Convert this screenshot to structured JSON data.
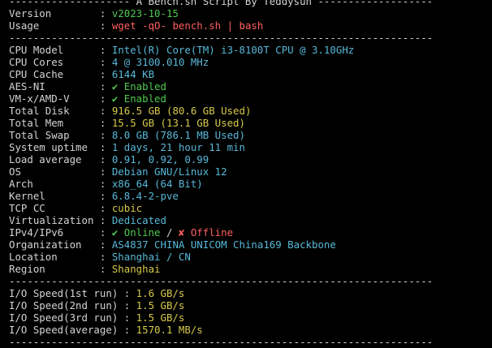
{
  "header_rule": "-------------------- A Bench.sh Script By Teddysun -------------------",
  "rule": "----------------------------------------------------------------------",
  "label_sep": " : ",
  "header_rows": [
    {
      "key": "Version",
      "value": "v2023-10-15",
      "color": "green"
    },
    {
      "key": "Usage",
      "value": "wget -qO- bench.sh | bash",
      "color": "red"
    }
  ],
  "info_rows": [
    {
      "key": "CPU Model",
      "value": "Intel(R) Core(TM) i3-8100T CPU @ 3.10GHz",
      "color": "cyan"
    },
    {
      "key": "CPU Cores",
      "value": "4 @ 3100.010 MHz",
      "color": "cyan"
    },
    {
      "key": "CPU Cache",
      "value": "6144 KB",
      "color": "cyan"
    },
    {
      "key": "AES-NI",
      "value": "✔ Enabled",
      "color": "green"
    },
    {
      "key": "VM-x/AMD-V",
      "value": "✔ Enabled",
      "color": "green"
    },
    {
      "key": "Total Disk",
      "value": "916.5 GB (80.6 GB Used)",
      "color": "yellow"
    },
    {
      "key": "Total Mem",
      "value": "15.5 GB (13.1 GB Used)",
      "color": "yellow"
    },
    {
      "key": "Total Swap",
      "value": "8.0 GB (786.1 MB Used)",
      "color": "cyan"
    },
    {
      "key": "System uptime",
      "value": "1 days, 21 hour 11 min",
      "color": "cyan"
    },
    {
      "key": "Load average",
      "value": "0.91, 0.92, 0.99",
      "color": "cyan"
    },
    {
      "key": "OS",
      "value": "Debian GNU/Linux 12",
      "color": "cyan"
    },
    {
      "key": "Arch",
      "value": "x86_64 (64 Bit)",
      "color": "cyan"
    },
    {
      "key": "Kernel",
      "value": "6.8.4-2-pve",
      "color": "cyan"
    },
    {
      "key": "TCP CC",
      "value": "cubic",
      "color": "yellow"
    },
    {
      "key": "Virtualization",
      "value": "Dedicated",
      "color": "cyan"
    }
  ],
  "ipv_row": {
    "key": "IPv4/IPv6",
    "online": "✔ Online",
    "slash": " / ",
    "offline": "✘ Offline"
  },
  "network_rows": [
    {
      "key": "Organization",
      "value": "AS4837 CHINA UNICOM China169 Backbone",
      "color": "cyan"
    },
    {
      "key": "Location",
      "value": "Shanghai / CN",
      "color": "cyan"
    },
    {
      "key": "Region",
      "value": "Shanghai",
      "color": "yellow"
    }
  ],
  "io_rows": [
    {
      "key": "I/O Speed(1st run)",
      "value": "1.6 GB/s",
      "color": "yellow"
    },
    {
      "key": "I/O Speed(2nd run)",
      "value": "1.5 GB/s",
      "color": "yellow"
    },
    {
      "key": "I/O Speed(3rd run)",
      "value": "1.5 GB/s",
      "color": "yellow"
    },
    {
      "key": "I/O Speed(average)",
      "value": "1570.1 MB/s",
      "color": "yellow"
    }
  ],
  "colors": {
    "background": "#000000",
    "text": "#d4d4d4",
    "green": "#4ec94e",
    "red": "#ff5f5f",
    "yellow": "#d7c94a",
    "cyan": "#58b8d8"
  }
}
